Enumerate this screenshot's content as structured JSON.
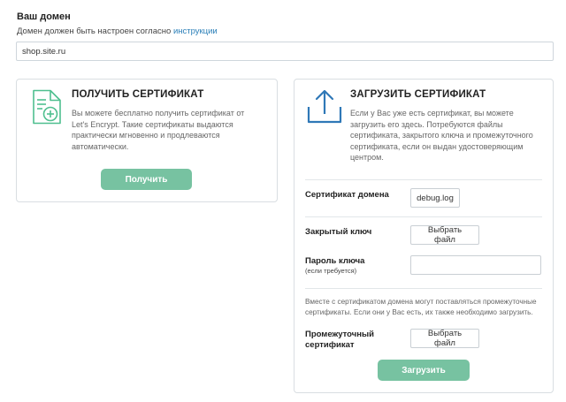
{
  "domain": {
    "label": "Ваш домен",
    "hint": "Домен должен быть настроен согласно",
    "hint_link": "инструкции",
    "value": "shop.site.ru"
  },
  "get_card": {
    "icon": "certificate-add-icon",
    "title": "ПОЛУЧИТЬ СЕРТИФИКАТ",
    "text_lines": [
      "Вы можете бесплатно получить сертификат от",
      "Let's Encrypt. Такие сертификаты выдаются",
      "практически мгновенно и продлеваются",
      "автоматически."
    ],
    "button": "Получить"
  },
  "upload_card": {
    "icon": "upload-icon",
    "title": "ЗАГРУЗИТЬ СЕРТИФИКАТ",
    "text_lines": [
      "Если у Вас уже есть сертификат, вы можете",
      "загрузить его здесь. Потребуются файлы",
      "сертификата, закрытого ключа и промежуточного",
      "сертификата, если он выдан удостоверяющим",
      "центром."
    ],
    "fields": {
      "domain_cert_label": "Сертификат домена",
      "domain_cert_file": "debug.log",
      "private_key_label": "Закрытый ключ",
      "private_key_button": "Выбрать файл",
      "key_password_label": "Пароль ключа",
      "key_password_sub": "(если требуется)",
      "key_password_value": "",
      "intermediate_note_lines": [
        "Вместе с сертификатом домена могут поставляться промежуточные",
        "сертификаты. Если они у Вас есть, их также необходимо загрузить."
      ],
      "intermediate_label_lines": [
        "Промежуточный",
        "сертификат"
      ],
      "intermediate_button": "Выбрать файл"
    },
    "button": "Загрузить"
  },
  "colors": {
    "accent_green": "#77c2a1",
    "icon_green": "#4fbf8f",
    "icon_blue": "#2f78b7",
    "link": "#2a7fb8"
  }
}
